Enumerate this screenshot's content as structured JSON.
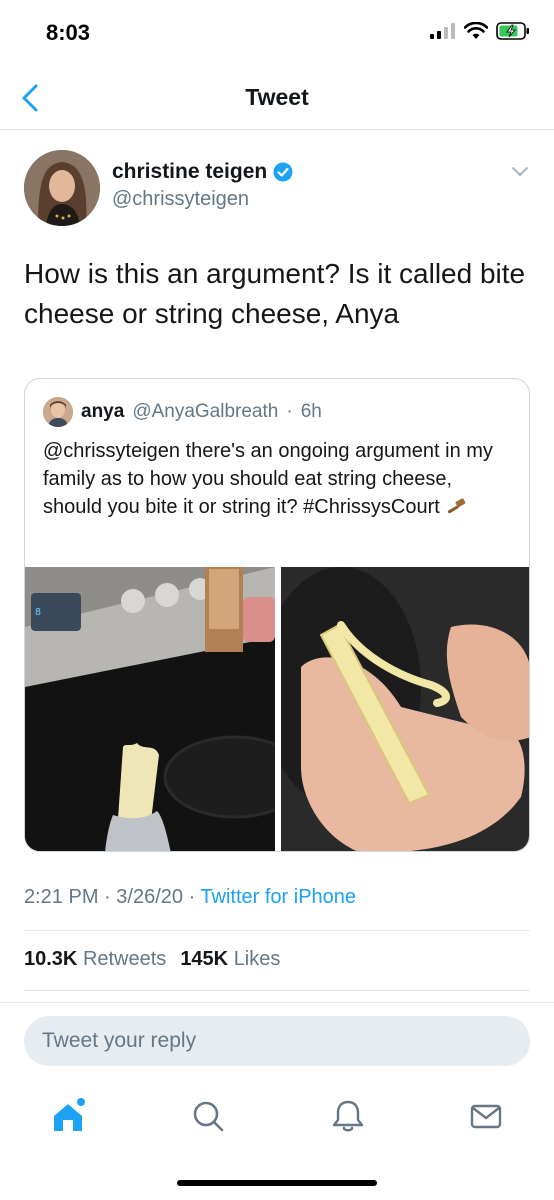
{
  "status_bar": {
    "time": "8:03"
  },
  "nav": {
    "title": "Tweet"
  },
  "tweet": {
    "author_name": "christine teigen",
    "author_handle": "@chrissyteigen",
    "text": "How is this an argument? Is it called bite cheese or string cheese, Anya",
    "time": "2:21 PM",
    "date": "3/26/20",
    "source": "Twitter for iPhone",
    "retweets_count": "10.3K",
    "retweets_label": "Retweets",
    "likes_count": "145K",
    "likes_label": "Likes"
  },
  "quoted_tweet": {
    "author_name": "anya",
    "author_handle": "@AnyaGalbreath",
    "age": "6h",
    "text": "@chrissyteigen there's an ongoing argument in my family as to how you should eat string cheese, should you bite it or string it? #ChrissysCourt"
  },
  "reply": {
    "placeholder": "Tweet your reply"
  },
  "tabs": [
    "home-icon",
    "search-icon",
    "notifications-icon",
    "messages-icon"
  ],
  "colors": {
    "accent": "#1da1f2",
    "text": "#14171a",
    "secondary": "#657786",
    "border": "#e1e8ed"
  }
}
